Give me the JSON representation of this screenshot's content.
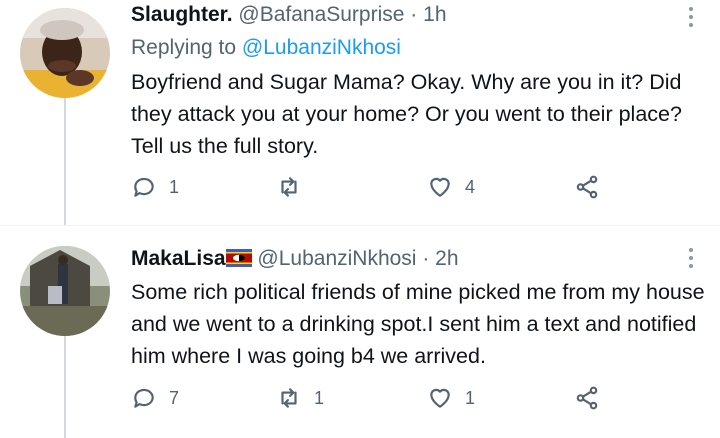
{
  "tweets": [
    {
      "name": "Slaughter.",
      "handle": "@BafanaSurprise",
      "dot": "·",
      "time": "1h",
      "replying_prefix": "Replying to ",
      "replying_to": "@LubanziNkhosi",
      "text": "Boyfriend and Sugar Mama? Okay. Why are you in it? Did they attack you at your home? Or you went to their place? Tell us the full story.",
      "replies": "1",
      "retweets": "",
      "likes": "4",
      "avatar_icon": "avatar-photo"
    },
    {
      "name": "MakaLisa",
      "handle": "@LubanziNkhosi",
      "dot": "·",
      "time": "2h",
      "text": "Some rich political friends of mine picked me from my house and we went to a drinking spot.I sent him a text and notified him where I was going b4 we arrived.",
      "replies": "7",
      "retweets": "1",
      "likes": "1",
      "avatar_icon": "avatar-photo",
      "name_badge": "eswatini-flag-icon"
    }
  ],
  "colors": {
    "text": "#0f1419",
    "muted": "#536471",
    "link": "#1d9bf0",
    "line": "#cfd9de"
  }
}
